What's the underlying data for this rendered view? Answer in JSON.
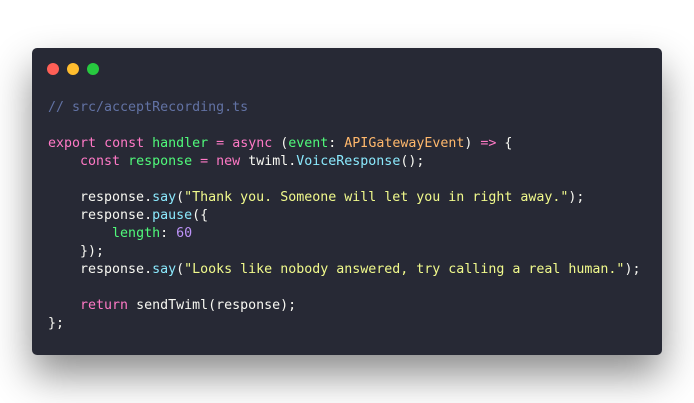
{
  "window": {
    "controls": [
      {
        "name": "close",
        "color": "#ff5f56"
      },
      {
        "name": "minimize",
        "color": "#ffbd2e"
      },
      {
        "name": "maximize",
        "color": "#27c93f"
      }
    ]
  },
  "code": {
    "language": "typescript",
    "lines": [
      [
        [
          "comment",
          "// src/acceptRecording.ts"
        ]
      ],
      [],
      [
        [
          "keyword",
          "export"
        ],
        [
          "plain",
          " "
        ],
        [
          "keyword",
          "const"
        ],
        [
          "plain",
          " "
        ],
        [
          "def",
          "handler"
        ],
        [
          "plain",
          " "
        ],
        [
          "keyword",
          "="
        ],
        [
          "plain",
          " "
        ],
        [
          "keyword",
          "async"
        ],
        [
          "plain",
          " ("
        ],
        [
          "def",
          "event"
        ],
        [
          "plain",
          ": "
        ],
        [
          "type",
          "APIGatewayEvent"
        ],
        [
          "plain",
          ") "
        ],
        [
          "keyword",
          "=>"
        ],
        [
          "plain",
          " {"
        ]
      ],
      [
        [
          "plain",
          "    "
        ],
        [
          "keyword",
          "const"
        ],
        [
          "plain",
          " "
        ],
        [
          "def",
          "response"
        ],
        [
          "plain",
          " "
        ],
        [
          "keyword",
          "="
        ],
        [
          "plain",
          " "
        ],
        [
          "keyword",
          "new"
        ],
        [
          "plain",
          " twiml."
        ],
        [
          "func",
          "VoiceResponse"
        ],
        [
          "plain",
          "();"
        ]
      ],
      [],
      [
        [
          "plain",
          "    response."
        ],
        [
          "func",
          "say"
        ],
        [
          "plain",
          "("
        ],
        [
          "string",
          "\"Thank you. Someone will let you in right away.\""
        ],
        [
          "plain",
          ");"
        ]
      ],
      [
        [
          "plain",
          "    response."
        ],
        [
          "func",
          "pause"
        ],
        [
          "plain",
          "({"
        ]
      ],
      [
        [
          "plain",
          "        "
        ],
        [
          "def",
          "length"
        ],
        [
          "plain",
          ": "
        ],
        [
          "number",
          "60"
        ]
      ],
      [
        [
          "plain",
          "    });"
        ]
      ],
      [
        [
          "plain",
          "    response."
        ],
        [
          "func",
          "say"
        ],
        [
          "plain",
          "("
        ],
        [
          "string",
          "\"Looks like nobody answered, try calling a real human.\""
        ],
        [
          "plain",
          ");"
        ]
      ],
      [],
      [
        [
          "plain",
          "    "
        ],
        [
          "keyword",
          "return"
        ],
        [
          "plain",
          " sendTwiml(response);"
        ]
      ],
      [
        [
          "plain",
          "};"
        ]
      ]
    ]
  }
}
